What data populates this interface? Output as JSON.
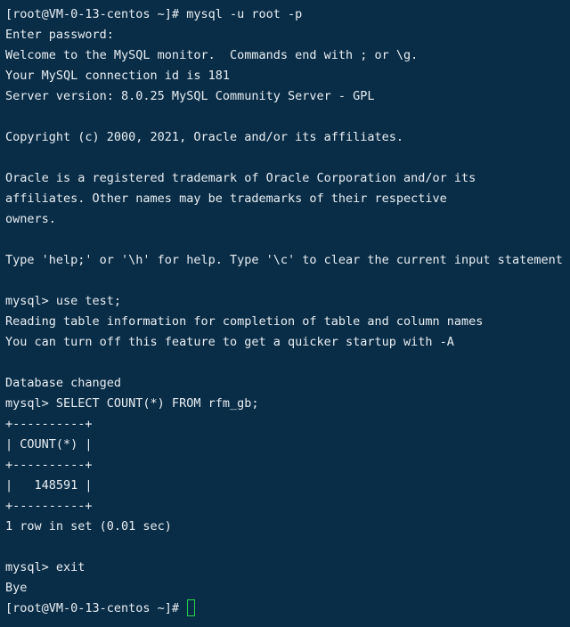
{
  "terminal": {
    "lines": [
      "[root@VM-0-13-centos ~]# mysql -u root -p",
      "Enter password:",
      "Welcome to the MySQL monitor.  Commands end with ; or \\g.",
      "Your MySQL connection id is 181",
      "Server version: 8.0.25 MySQL Community Server - GPL",
      "",
      "Copyright (c) 2000, 2021, Oracle and/or its affiliates.",
      "",
      "Oracle is a registered trademark of Oracle Corporation and/or its",
      "affiliates. Other names may be trademarks of their respective",
      "owners.",
      "",
      "Type 'help;' or '\\h' for help. Type '\\c' to clear the current input statement.",
      "",
      "mysql> use test;",
      "Reading table information for completion of table and column names",
      "You can turn off this feature to get a quicker startup with -A",
      "",
      "Database changed",
      "mysql> SELECT COUNT(*) FROM rfm_gb;",
      "+----------+",
      "| COUNT(*) |",
      "+----------+"
    ],
    "result_row": {
      "prefix": "|   ",
      "value": "148591",
      "suffix": " |"
    },
    "lines_after": [
      "+----------+",
      "1 row in set (0.01 sec)",
      "",
      "mysql> exit",
      "Bye"
    ],
    "final_prompt": "[root@VM-0-13-centos ~]# "
  }
}
